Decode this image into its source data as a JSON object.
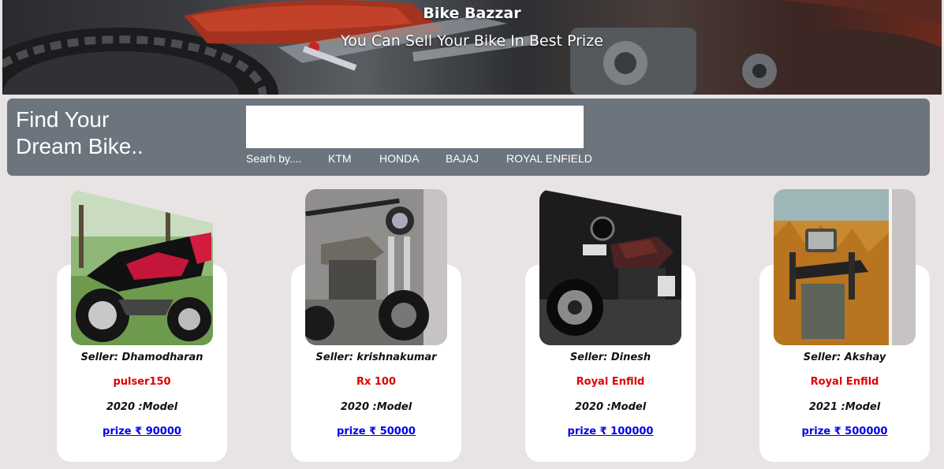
{
  "header": {
    "title": "Bike Bazzar",
    "subtitle": "You Can Sell Your Bike In Best Prize"
  },
  "search": {
    "heading_line1": "Find Your",
    "heading_line2": "Dream Bike..",
    "input_value": "",
    "filters": [
      "Searh by....",
      "KTM",
      "HONDA",
      "BAJAJ",
      "ROYAL ENFIELD"
    ]
  },
  "listings": [
    {
      "seller": "Seller: Dhamodharan",
      "model": "pulser150",
      "year": "2020 :Model",
      "price": "prize ₹ 90000",
      "photo_icon": "motorcycle-photo"
    },
    {
      "seller": "Seller: krishnakumar",
      "model": "Rx 100",
      "year": "2020 :Model",
      "price": "prize ₹ 50000",
      "photo_icon": "motorcycle-photo"
    },
    {
      "seller": "Seller: Dinesh",
      "model": "Royal Enfild",
      "year": "2020 :Model",
      "price": "prize ₹ 100000",
      "photo_icon": "motorcycle-photo"
    },
    {
      "seller": "Seller: Akshay",
      "model": "Royal Enfild",
      "year": "2021 :Model",
      "price": "prize ₹ 500000",
      "photo_icon": "motorcycle-photo"
    }
  ],
  "colors": {
    "panel": "#6c757d",
    "model_text": "#e00000",
    "price_link": "#0000ee",
    "page_bg": "#e8e4e3"
  }
}
